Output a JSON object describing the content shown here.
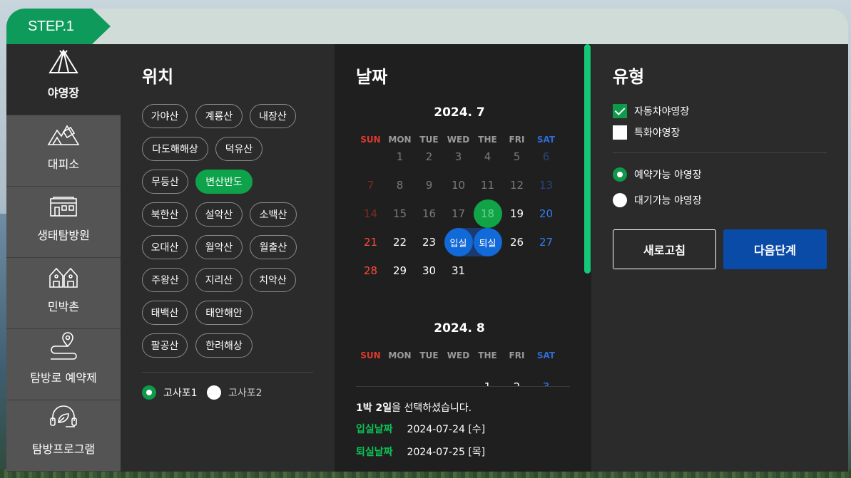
{
  "step": {
    "label": "STEP.1"
  },
  "categories": [
    {
      "label": "야영장",
      "icon": "tent-icon",
      "active": true
    },
    {
      "label": "대피소",
      "icon": "shelter-icon",
      "active": false
    },
    {
      "label": "생태탐방원",
      "icon": "eco-center-icon",
      "active": false
    },
    {
      "label": "민박촌",
      "icon": "village-icon",
      "active": false
    },
    {
      "label": "탐방로 예약제",
      "icon": "trail-icon",
      "active": false
    },
    {
      "label": "탐방프로그램",
      "icon": "program-icon",
      "active": false
    }
  ],
  "location": {
    "title": "위치",
    "chips": [
      "가야산",
      "계룡산",
      "내장산",
      "다도해해상",
      "덕유산",
      "무등산",
      "변산반도",
      "북한산",
      "설악산",
      "소백산",
      "오대산",
      "월악산",
      "월출산",
      "주왕산",
      "지리산",
      "치악산",
      "태백산",
      "태안해안",
      "팔공산",
      "한려해상"
    ],
    "selected": "변산반도",
    "sites": [
      {
        "label": "고사포1",
        "checked": true
      },
      {
        "label": "고사포2",
        "checked": false
      }
    ]
  },
  "date": {
    "title": "날짜",
    "weekdays": [
      "SUN",
      "MON",
      "TUE",
      "WED",
      "THE",
      "FRI",
      "SAT"
    ],
    "month1": {
      "title": "2024. 7",
      "days": [
        "1",
        "2",
        "3",
        "4",
        "5",
        "6",
        "7",
        "8",
        "9",
        "10",
        "11",
        "12",
        "13",
        "14",
        "15",
        "16",
        "17",
        "18",
        "19",
        "20",
        "21",
        "22",
        "23",
        "입실",
        "퇴실",
        "26",
        "27",
        "28",
        "29",
        "30",
        "31"
      ]
    },
    "month2": {
      "title": "2024. 8",
      "days": [
        "1",
        "2",
        "3"
      ]
    },
    "summary_bold": "1박 2일",
    "summary_rest": "을 선택하셨습니다.",
    "checkin_label": "입실날짜",
    "checkin_value": "2024-07-24 [수]",
    "checkout_label": "퇴실날짜",
    "checkout_value": "2024-07-25 [목]"
  },
  "type": {
    "title": "유형",
    "checkboxes": [
      {
        "label": "자동차야영장",
        "checked": true
      },
      {
        "label": "특화야영장",
        "checked": false
      }
    ],
    "radios": [
      {
        "label": "예약가능 야영장",
        "checked": true
      },
      {
        "label": "대기가능 야영장",
        "checked": false
      }
    ],
    "refresh_label": "새로고침",
    "next_label": "다음단계"
  },
  "colors": {
    "accent_green": "#0ea34a",
    "primary_blue": "#0a4ba8",
    "selected_blue": "#1269d8",
    "sunday_red": "#ff4a3d",
    "saturday_blue": "#2f7ef0"
  }
}
